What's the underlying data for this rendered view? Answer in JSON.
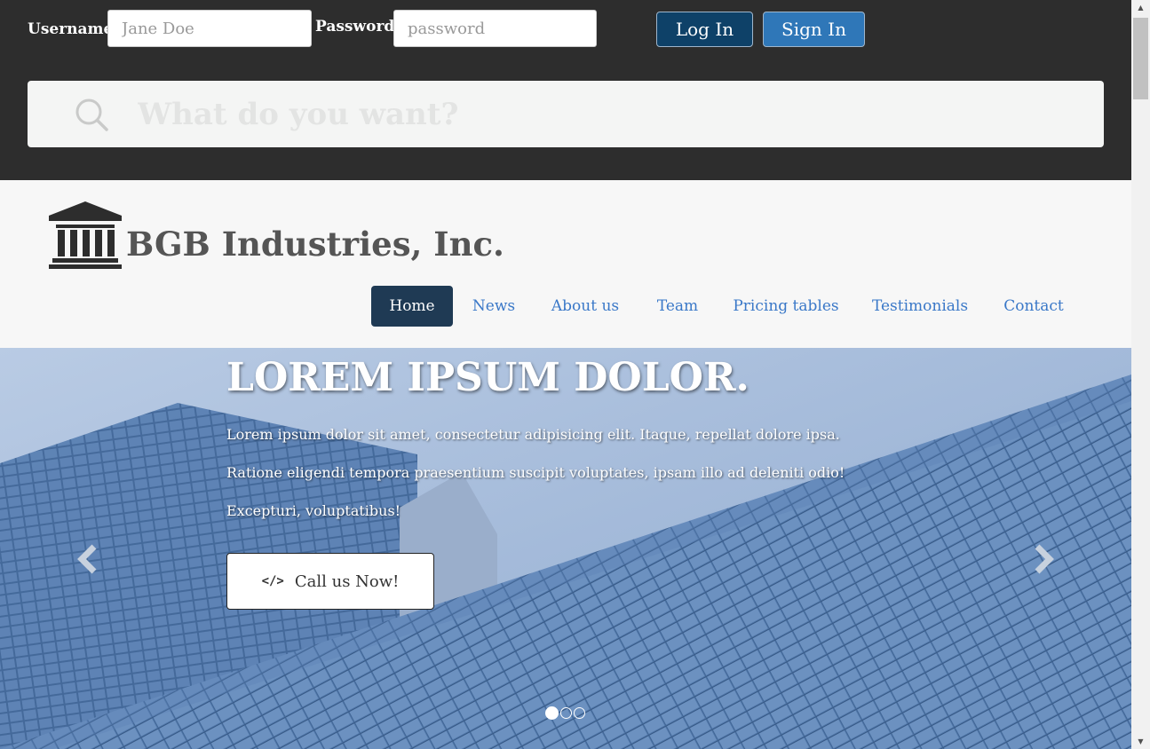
{
  "login": {
    "username_label": "Username:",
    "username_placeholder": "Jane Doe",
    "password_label": "Password:",
    "password_placeholder": "password",
    "login_button": "Log In",
    "signin_button": "Sign In"
  },
  "search": {
    "placeholder": "What do you want?",
    "icon": "search-icon"
  },
  "header": {
    "logo_icon": "bank-icon",
    "brand": "BGB Industries, Inc."
  },
  "nav": {
    "items": [
      {
        "label": "Home",
        "active": true
      },
      {
        "label": "News"
      },
      {
        "label": "About us"
      },
      {
        "label": "Team"
      },
      {
        "label": "Pricing tables"
      },
      {
        "label": "Testimonials"
      },
      {
        "label": "Contact"
      }
    ]
  },
  "hero": {
    "title": "LOREM IPSUM DOLOR.",
    "text": "Lorem ipsum dolor sit amet, consectetur adipisicing elit. Itaque, repellat dolore ipsa. Ratione eligendi tempora praesentium suscipit voluptates, ipsam illo ad deleniti odio! Excepturi, voluptatibus!",
    "cta_label": "Call us Now!",
    "cta_icon": "code-icon",
    "slides": 3,
    "active_slide": 1
  },
  "colors": {
    "topbar": "#2d2d2d",
    "login_button": "#0e4168",
    "signin_button": "#2f77b8",
    "nav_active": "#1f3a54",
    "nav_link": "#3a78c8"
  }
}
